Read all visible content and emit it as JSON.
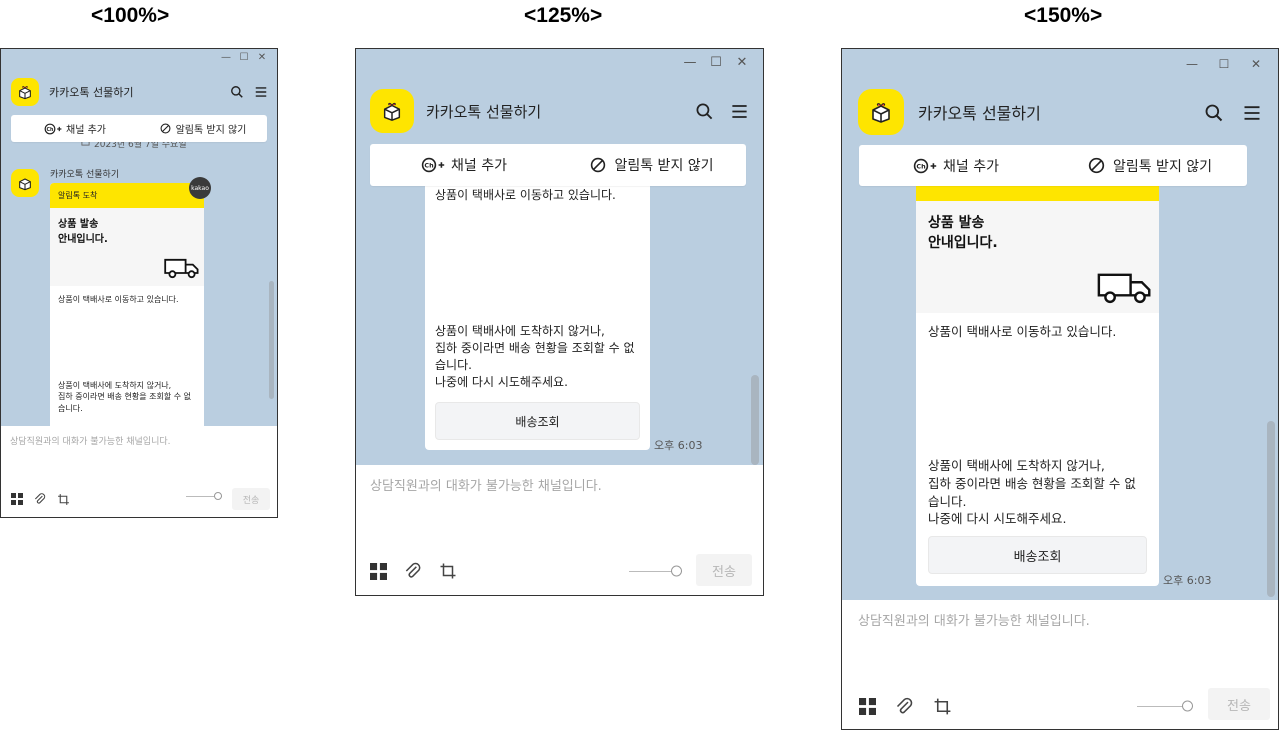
{
  "zoom_labels": [
    "<100%>",
    "<125%>",
    "<150%>"
  ],
  "app": {
    "title": "카카오톡 선물하기",
    "add_channel": "채널 추가",
    "no_notice": "알림톡 받지 않기",
    "date_divider": "2023년 6월 7일 수요일",
    "sender": "카카오톡 선물하기",
    "badge": "kakao",
    "msg_header": "알림톡 도착",
    "hero_line1": "상품 발송",
    "hero_line2": "안내입니다.",
    "text1": "상품이 택배사로 이동하고 있습니다.",
    "text2_1": "상품이 택배사에 도착하지 않거나,",
    "text2_2": "집하 중이라면 배송 현황을 조회할 수 없습니다.",
    "text2_3": "나중에 다시 시도해주세요.",
    "track_button": "배송조회",
    "time": "오후 6:03",
    "input_placeholder": "상담직원과의 대화가 불가능한 채널입니다.",
    "send": "전송",
    "window_controls": [
      "—",
      "☐",
      "✕"
    ]
  },
  "icons": [
    "gift-box-icon",
    "search-icon",
    "menu-icon",
    "channel-add-icon",
    "block-icon",
    "calendar-icon",
    "delivery-truck-icon",
    "emoticon-grid-icon",
    "attach-clip-icon",
    "crop-icon"
  ],
  "colors": {
    "chat_bg": "#bacee0",
    "brand_yellow": "#fee500",
    "send_disabled": "#f3f3f3"
  }
}
